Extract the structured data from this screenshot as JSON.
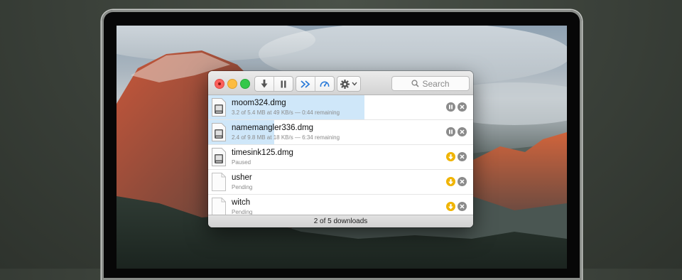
{
  "window": {
    "toolbar": {
      "icons": [
        "download-icon",
        "pause-icon",
        "fast-forward-icon",
        "speedometer-icon",
        "gear-icon",
        "chevron-down-icon"
      ],
      "search_placeholder": "Search"
    },
    "downloads": [
      {
        "name": "moom324.dmg",
        "status": "3.2 of 5.4 MB at 49 KB/s — 0:44 remaining",
        "progress": 0.59,
        "icon": "disk-image-icon",
        "action": "pause"
      },
      {
        "name": "namemangler336.dmg",
        "status": "2.4 of 9.8 MB at 18 KB/s — 6:34 remaining",
        "progress": 0.25,
        "icon": "disk-image-icon",
        "action": "pause"
      },
      {
        "name": "timesink125.dmg",
        "status": "Paused",
        "progress": 0,
        "icon": "disk-image-icon",
        "action": "resume"
      },
      {
        "name": "usher",
        "status": "Pending",
        "progress": 0,
        "icon": "document-icon",
        "action": "resume"
      },
      {
        "name": "witch",
        "status": "Pending",
        "progress": 0,
        "icon": "document-icon",
        "action": "resume"
      }
    ],
    "footer": "2 of 5 downloads"
  },
  "colors": {
    "progress": "#cfe7f9",
    "resume": "#f0b400",
    "neutral": "#8b8b8b"
  }
}
